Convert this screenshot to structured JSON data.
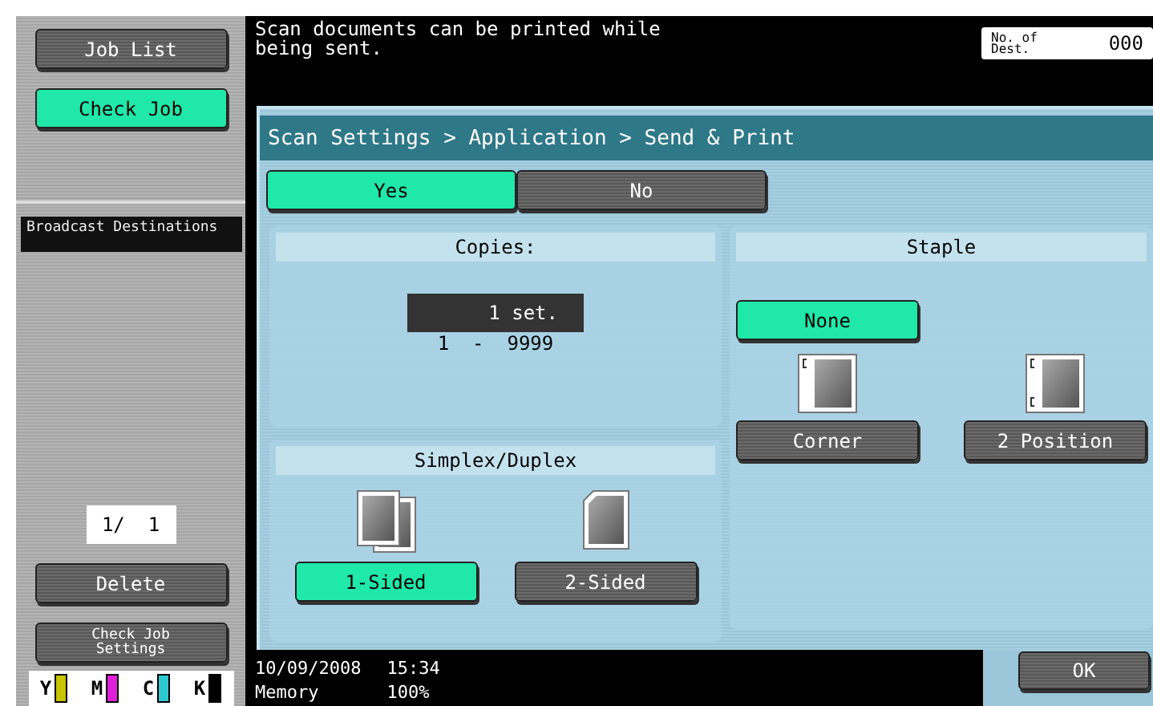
{
  "sidebar": {
    "buttons": [
      {
        "label": "Job List",
        "selected": false
      },
      {
        "label": "Check Job",
        "selected": true
      }
    ],
    "section_title": "Broadcast Destinations",
    "page": "1/  1",
    "delete": "Delete",
    "check_job_settings": "Check Job Settings",
    "toner": [
      {
        "label": "Y",
        "color": "#c8c400"
      },
      {
        "label": "M",
        "color": "#e020d8"
      },
      {
        "label": "C",
        "color": "#30c8d0"
      },
      {
        "label": "K",
        "color": "#000000"
      }
    ]
  },
  "message": "Scan documents can be printed while being sent.",
  "dest_count": {
    "label": "No. of Dest.",
    "value": "000"
  },
  "breadcrumb": "Scan Settings > Application > Send & Print",
  "toggle": [
    {
      "label": "Yes",
      "selected": true
    },
    {
      "label": "No",
      "selected": false
    }
  ],
  "copies": {
    "title": "Copies:",
    "value": "1 set.",
    "range": "1  -  9999"
  },
  "simplex": {
    "title": "Simplex/Duplex",
    "options": [
      {
        "label": "1-Sided",
        "selected": true,
        "kind": "one"
      },
      {
        "label": "2-Sided",
        "selected": false,
        "kind": "two"
      }
    ]
  },
  "staple": {
    "title": "Staple",
    "options": [
      {
        "label": "None",
        "selected": true,
        "kind": "none"
      },
      {
        "label": "Corner",
        "selected": false,
        "kind": "corner"
      },
      {
        "label": "2 Position",
        "selected": false,
        "kind": "two"
      }
    ]
  },
  "footer": {
    "date": "10/09/2008",
    "time": "15:34",
    "memory_label": "Memory",
    "memory_value": "100%"
  },
  "ok": "OK"
}
